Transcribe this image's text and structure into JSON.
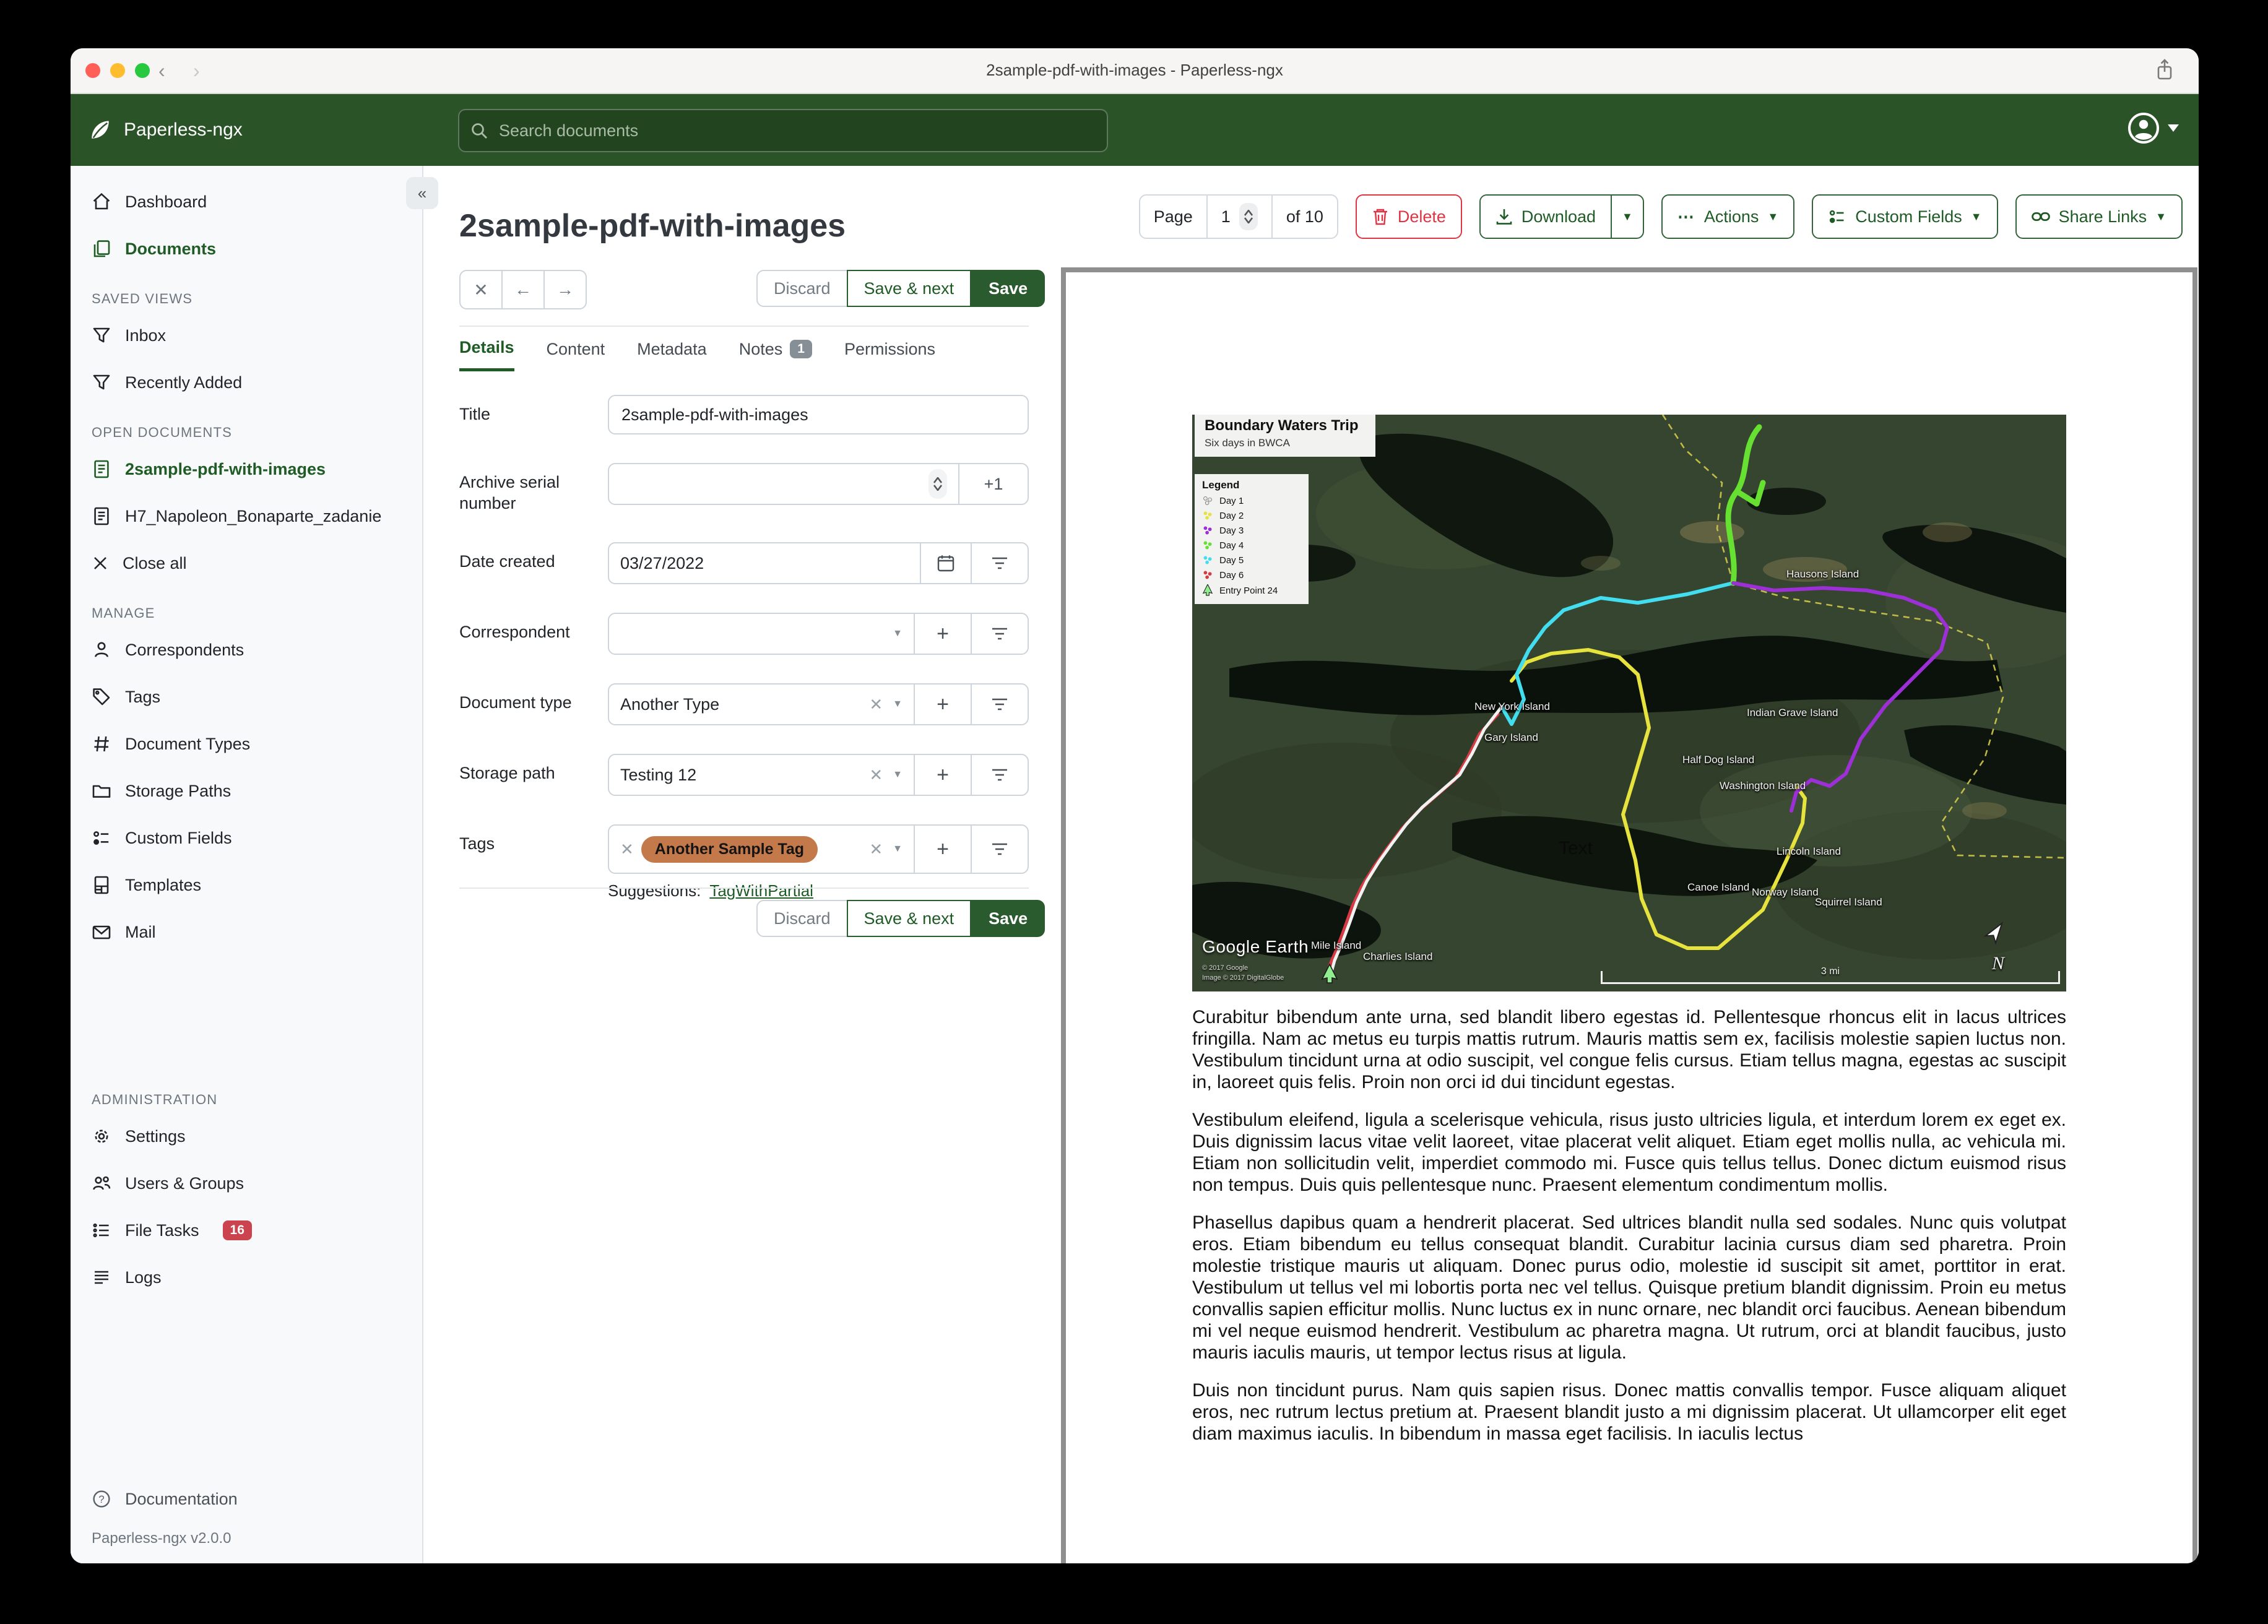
{
  "window": {
    "title": "2sample-pdf-with-images - Paperless-ngx"
  },
  "header": {
    "brand": "Paperless-ngx",
    "search_placeholder": "Search documents"
  },
  "sidebar": {
    "dashboard": "Dashboard",
    "documents": "Documents",
    "saved_views_header": "SAVED VIEWS",
    "inbox": "Inbox",
    "recently_added": "Recently Added",
    "open_documents_header": "OPEN DOCUMENTS",
    "open_doc_1": "2sample-pdf-with-images",
    "open_doc_2": "H7_Napoleon_Bonaparte_zadanie",
    "close_all": "Close all",
    "manage_header": "MANAGE",
    "correspondents": "Correspondents",
    "tags": "Tags",
    "document_types": "Document Types",
    "storage_paths": "Storage Paths",
    "custom_fields": "Custom Fields",
    "templates": "Templates",
    "mail": "Mail",
    "admin_header": "ADMINISTRATION",
    "settings": "Settings",
    "users_groups": "Users & Groups",
    "file_tasks": "File Tasks",
    "file_tasks_badge": "16",
    "logs": "Logs",
    "documentation": "Documentation",
    "version": "Paperless-ngx v2.0.0"
  },
  "toolbar": {
    "page_label": "Page",
    "page_value": "1",
    "page_of": "of 10",
    "delete": "Delete",
    "download": "Download",
    "actions": "Actions",
    "custom_fields": "Custom Fields",
    "share_links": "Share Links"
  },
  "doc": {
    "title": "2sample-pdf-with-images",
    "discard": "Discard",
    "save_next": "Save & next",
    "save": "Save",
    "tabs": {
      "details": "Details",
      "content": "Content",
      "metadata": "Metadata",
      "notes": "Notes",
      "notes_badge": "1",
      "permissions": "Permissions"
    },
    "fields": {
      "title_label": "Title",
      "title_value": "2sample-pdf-with-images",
      "asn_label": "Archive serial number",
      "asn_add": "+1",
      "date_label": "Date created",
      "date_value": "03/27/2022",
      "correspondent_label": "Correspondent",
      "doctype_label": "Document type",
      "doctype_value": "Another Type",
      "storage_label": "Storage path",
      "storage_value": "Testing 12",
      "tags_label": "Tags",
      "tag_chip": "Another Sample Tag",
      "suggestions_label": "Suggestions:",
      "suggestion_link": "TagWithPartial"
    }
  },
  "preview": {
    "map": {
      "title": "Boundary Waters Trip",
      "subtitle": "Six days in BWCA",
      "legend_title": "Legend",
      "legend": [
        {
          "label": "Day 1",
          "color": "#e9e9e9"
        },
        {
          "label": "Day 2",
          "color": "#e6e23e"
        },
        {
          "label": "Day 3",
          "color": "#9d2fd6"
        },
        {
          "label": "Day 4",
          "color": "#66e132"
        },
        {
          "label": "Day 5",
          "color": "#43ddf0"
        },
        {
          "label": "Day 6",
          "color": "#d63a44"
        },
        {
          "label": "Entry Point 24",
          "color": "#90ee90"
        }
      ],
      "labels": [
        {
          "text": "Hausons Island"
        },
        {
          "text": "New York Island"
        },
        {
          "text": "Gary Island"
        },
        {
          "text": "Indian Grave Island"
        },
        {
          "text": "Half Dog Island"
        },
        {
          "text": "Washington Island"
        },
        {
          "text": "Lincoln Island"
        },
        {
          "text": "Canoe Island"
        },
        {
          "text": "Norway Island"
        },
        {
          "text": "Squirrel Island"
        },
        {
          "text": "Mile Island"
        },
        {
          "text": "Charlies Island"
        }
      ],
      "text_label": "Text",
      "google_earth": "Google Earth",
      "copyright1": "© 2017 Google",
      "copyright2": "Image © 2017 DigitalGlobe",
      "scale": "3 mi",
      "north": "N"
    },
    "paragraphs": [
      "Curabitur bibendum ante urna, sed blandit libero egestas id. Pellentesque rhoncus elit in lacus ultrices fringilla. Nam ac metus eu turpis mattis rutrum. Mauris mattis sem ex, facilisis molestie sapien luctus non. Vestibulum tincidunt urna at odio suscipit, vel congue felis cursus. Etiam tellus magna, egestas ac suscipit in, laoreet quis felis. Proin non orci id dui tincidunt egestas.",
      "Vestibulum eleifend, ligula a scelerisque vehicula, risus justo ultricies ligula, et interdum lorem ex eget ex. Duis dignissim lacus vitae velit laoreet, vitae placerat velit aliquet. Etiam eget mollis nulla, ac vehicula mi. Etiam non sollicitudin velit, imperdiet commodo mi. Fusce quis tellus tellus. Donec dictum euismod risus non tempus. Duis quis pellentesque nunc. Praesent elementum condimentum mollis.",
      "Phasellus dapibus quam a hendrerit placerat. Sed ultrices blandit nulla sed sodales. Nunc quis volutpat eros. Etiam bibendum eu tellus consequat blandit. Curabitur lacinia cursus diam sed pharetra. Proin molestie tristique mauris ut aliquam. Donec purus odio, molestie id suscipit sit amet, porttitor in erat. Vestibulum ut tellus vel mi lobortis porta nec vel tellus. Quisque pretium blandit dignissim. Proin eu metus convallis sapien efficitur mollis. Nunc luctus ex in nunc ornare, nec blandit orci faucibus. Aenean bibendum mi vel neque euismod hendrerit. Vestibulum ac pharetra magna. Ut rutrum, orci at blandit faucibus, justo mauris iaculis mauris, ut tempor lectus risus at ligula.",
      "Duis non tincidunt purus. Nam quis sapien risus. Donec mattis convallis tempor. Fusce aliquam aliquet eros, nec rutrum lectus pretium at. Praesent blandit justo a mi dignissim placerat. Ut ullamcorper elit eget diam maximus iaculis. In bibendum in massa eget facilisis. In iaculis lectus"
    ]
  }
}
